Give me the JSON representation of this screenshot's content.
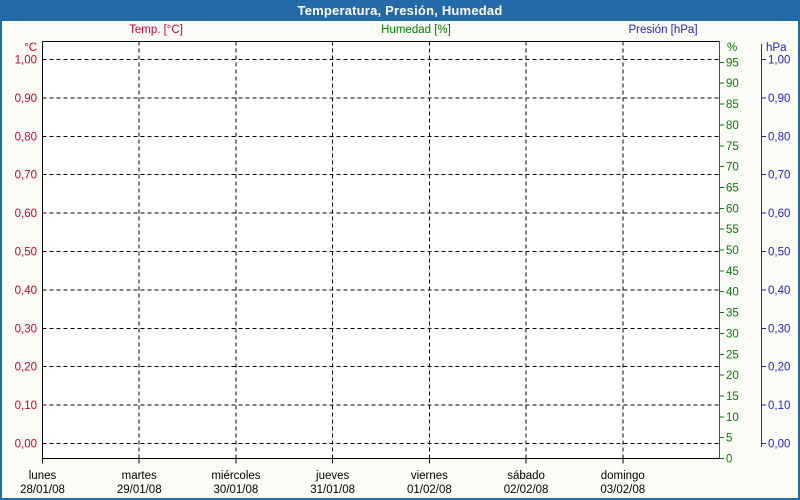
{
  "window": {
    "title": "Temperatura, Presión, Humedad"
  },
  "chart_data": {
    "type": "line",
    "title": "Temperatura, Presión, Humedad",
    "series": [
      {
        "name": "Temp. [°C]",
        "unit": "°C",
        "color": "#cc0033",
        "axis": "left_temp",
        "values": []
      },
      {
        "name": "Humedad [%]",
        "unit": "%",
        "color": "#008000",
        "axis": "right_humidity",
        "values": []
      },
      {
        "name": "Presión [hPa]",
        "unit": "hPa",
        "color": "#2222cc",
        "axis": "right_pressure",
        "values": []
      }
    ],
    "note": "empty plot - axes and grid only, no data points drawn",
    "grid": {
      "horizontal_dashed": true,
      "vertical_dashed": true
    },
    "x_axis": {
      "tick_labels": [
        {
          "day": "lunes",
          "date": "28/01/08"
        },
        {
          "day": "martes",
          "date": "29/01/08"
        },
        {
          "day": "miércoles",
          "date": "30/01/08"
        },
        {
          "day": "jueves",
          "date": "31/01/08"
        },
        {
          "day": "viernes",
          "date": "01/02/08"
        },
        {
          "day": "sábado",
          "date": "02/02/08"
        },
        {
          "day": "domingo",
          "date": "03/02/08"
        }
      ]
    },
    "y_axes": {
      "temp": {
        "label": "°C",
        "color": "#cc0033",
        "min": 0,
        "max": 1,
        "tick_labels": [
          "1,00",
          "0,90",
          "0,80",
          "0,70",
          "0,60",
          "0,50",
          "0,40",
          "0,30",
          "0,20",
          "0,10",
          "0,00"
        ]
      },
      "humidity": {
        "label": "%",
        "color": "#008000",
        "min": 0,
        "max": 100,
        "tick_step": 5,
        "tick_labels": [
          "95",
          "90",
          "85",
          "80",
          "75",
          "70",
          "65",
          "60",
          "55",
          "50",
          "45",
          "40",
          "35",
          "30",
          "25",
          "20",
          "15",
          "10",
          "5",
          "0"
        ]
      },
      "pressure": {
        "label": "hPa",
        "color": "#2222cc",
        "min": 0,
        "max": 1,
        "tick_labels": [
          "1,00",
          "0,90",
          "0,80",
          "0,70",
          "0,60",
          "0,50",
          "0,40",
          "0,30",
          "0,20",
          "0,10",
          "0,00"
        ]
      }
    }
  }
}
